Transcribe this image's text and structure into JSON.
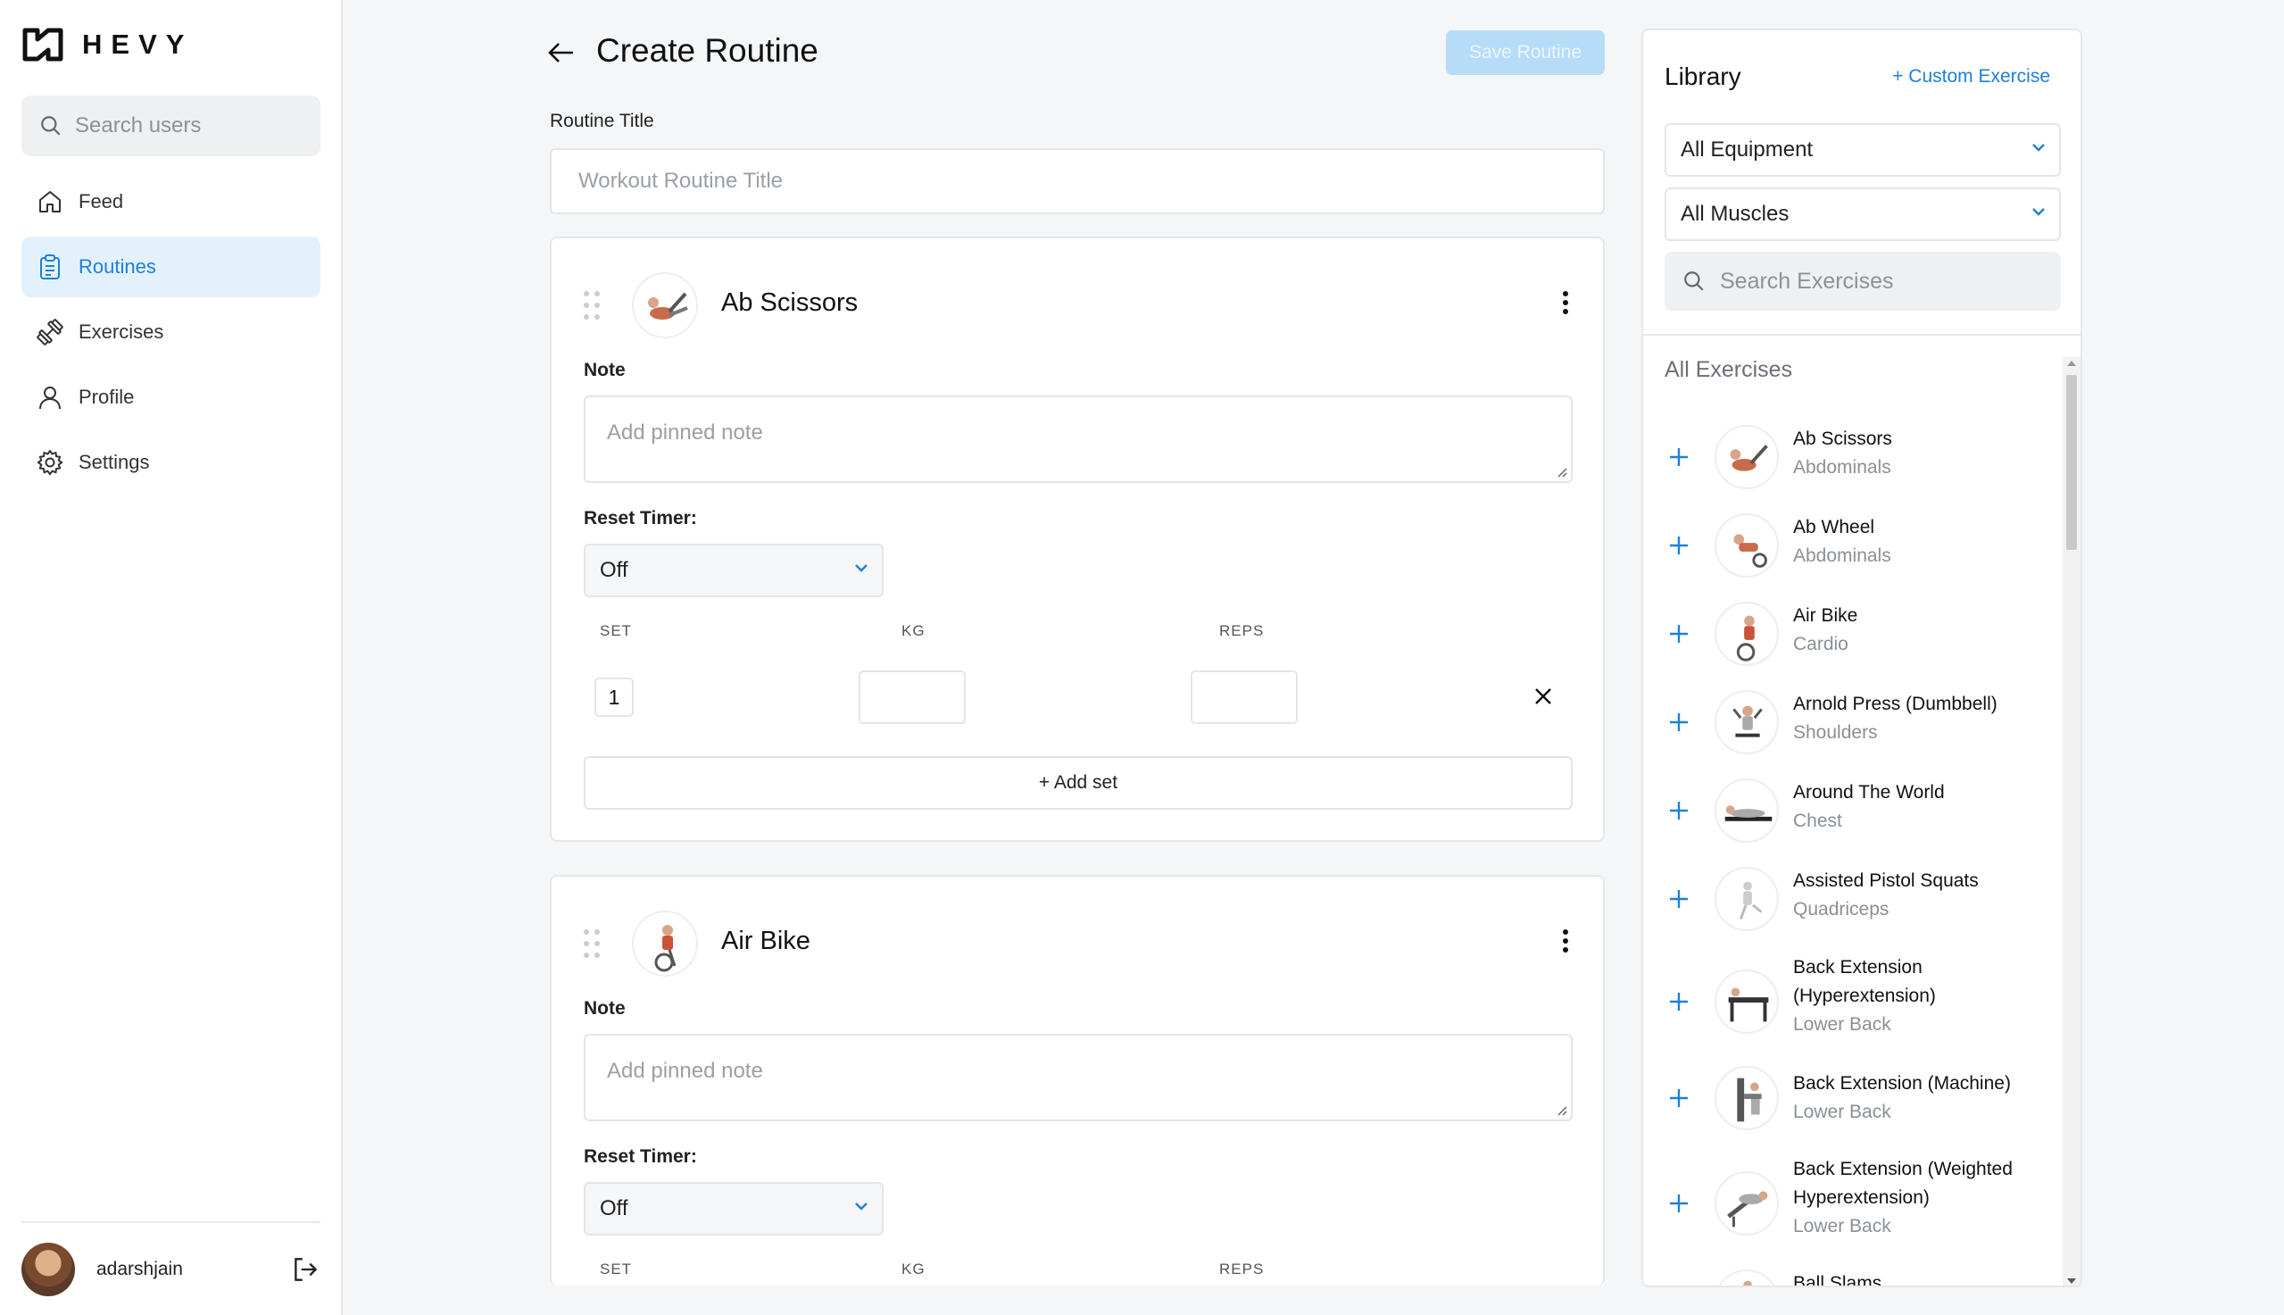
{
  "brand": {
    "name": "HEVY"
  },
  "sidebar": {
    "search_placeholder": "Search users",
    "items": [
      {
        "label": "Feed",
        "icon": "home-icon"
      },
      {
        "label": "Routines",
        "icon": "clipboard-icon",
        "active": true
      },
      {
        "label": "Exercises",
        "icon": "dumbbell-icon"
      },
      {
        "label": "Profile",
        "icon": "user-icon"
      },
      {
        "label": "Settings",
        "icon": "gear-icon"
      }
    ],
    "user": {
      "name": "adarshjain"
    }
  },
  "header": {
    "title": "Create Routine",
    "save_label": "Save Routine"
  },
  "routine": {
    "title_label": "Routine Title",
    "title_placeholder": "Workout Routine Title"
  },
  "exercises": [
    {
      "name": "Ab Scissors",
      "note_label": "Note",
      "note_placeholder": "Add pinned note",
      "timer_label": "Reset Timer:",
      "timer_value": "Off",
      "columns": [
        "SET",
        "KG",
        "REPS"
      ],
      "sets": [
        {
          "set": "1"
        }
      ],
      "add_set_label": "+ Add set"
    },
    {
      "name": "Air Bike",
      "note_label": "Note",
      "note_placeholder": "Add pinned note",
      "timer_label": "Reset Timer:",
      "timer_value": "Off",
      "columns": [
        "SET",
        "KG",
        "REPS"
      ]
    }
  ],
  "library": {
    "title": "Library",
    "custom_label": "+ Custom Exercise",
    "equipment_value": "All Equipment",
    "muscles_value": "All Muscles",
    "search_placeholder": "Search Exercises",
    "section_label": "All Exercises",
    "items": [
      {
        "name": "Ab Scissors",
        "muscle": "Abdominals"
      },
      {
        "name": "Ab Wheel",
        "muscle": "Abdominals"
      },
      {
        "name": "Air Bike",
        "muscle": "Cardio"
      },
      {
        "name": "Arnold Press (Dumbbell)",
        "muscle": "Shoulders"
      },
      {
        "name": "Around The World",
        "muscle": "Chest"
      },
      {
        "name": "Assisted Pistol Squats",
        "muscle": "Quadriceps"
      },
      {
        "name": "Back Extension (Hyperextension)",
        "muscle": "Lower Back"
      },
      {
        "name": "Back Extension (Machine)",
        "muscle": "Lower Back"
      },
      {
        "name": "Back Extension (Weighted Hyperextension)",
        "muscle": "Lower Back"
      },
      {
        "name": "Ball Slams",
        "muscle": ""
      }
    ]
  },
  "colors": {
    "accent": "#1d80d9",
    "active_bg": "#e3f1fc",
    "save_disabled": "#b7dcf7"
  }
}
